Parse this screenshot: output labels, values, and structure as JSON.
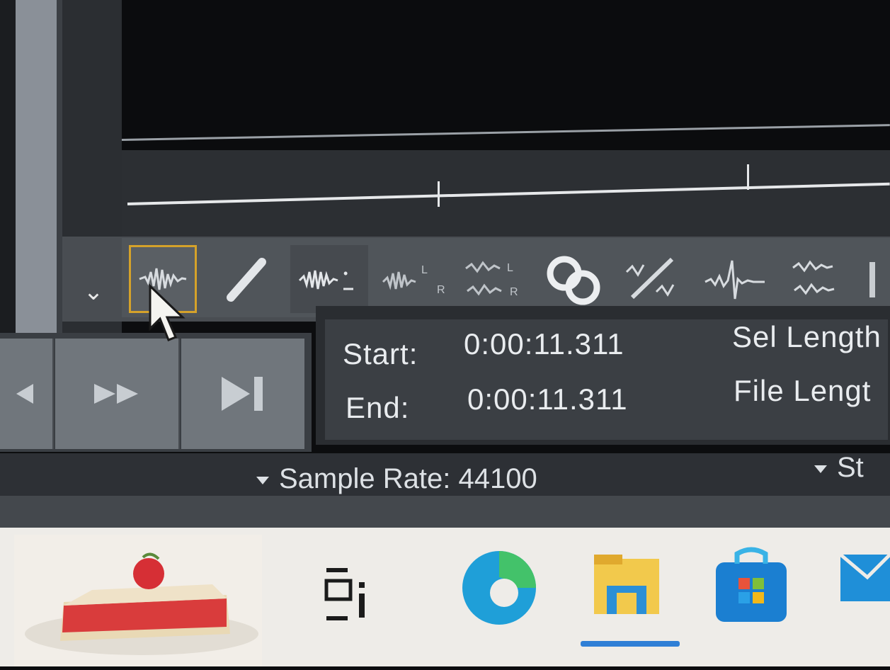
{
  "time_panel": {
    "start_label": "Start:",
    "start_value": "0:00:11.311",
    "end_label": "End:",
    "end_value": "0:00:11.311",
    "sel_length_label": "Sel Length",
    "file_length_label": "File Lengt"
  },
  "status_bar": {
    "sample_rate": "Sample Rate: 44100",
    "right_item": "St"
  },
  "toolbar": {
    "tools": [
      "select-tool",
      "pencil-tool",
      "multichannel-tool",
      "stereo-left-tool",
      "stereo-lr-tool",
      "link-tool",
      "sparkle-tool",
      "spectral-tool",
      "mix-tool"
    ]
  },
  "colors": {
    "accent": "#d5a22a",
    "toolbar": "#50555a",
    "background": "#0b0c0e"
  }
}
